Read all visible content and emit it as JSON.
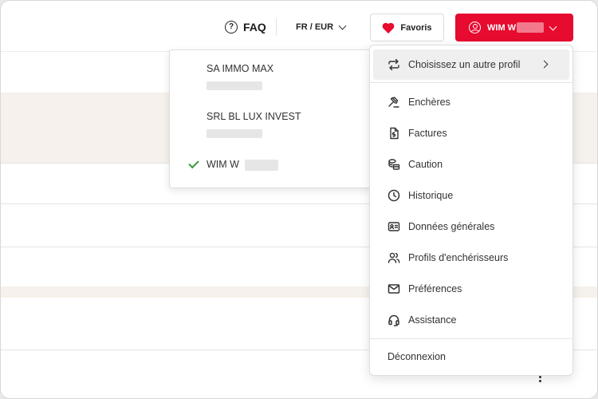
{
  "header": {
    "faq_label": "FAQ",
    "lang_label": "FR / EUR",
    "favorites_label": "Favoris",
    "profile_label": "WIM W"
  },
  "profile_submenu": {
    "items": [
      {
        "name": "SA IMMO MAX",
        "selected": false
      },
      {
        "name": "SRL BL LUX INVEST",
        "selected": false
      },
      {
        "name": "WIM W",
        "selected": true
      }
    ]
  },
  "menu": {
    "items": [
      {
        "label": "Choisissez un autre profil",
        "icon": "swap-icon"
      },
      {
        "label": "Enchères",
        "icon": "gavel-icon"
      },
      {
        "label": "Factures",
        "icon": "invoice-icon"
      },
      {
        "label": "Caution",
        "icon": "coins-icon"
      },
      {
        "label": "Historique",
        "icon": "clock-icon"
      },
      {
        "label": "Données générales",
        "icon": "id-card-icon"
      },
      {
        "label": "Profils d'enchérisseurs",
        "icon": "users-icon"
      },
      {
        "label": "Préférences",
        "icon": "mail-icon"
      },
      {
        "label": "Assistance",
        "icon": "headset-icon"
      }
    ],
    "logout_label": "Déconnexion"
  },
  "colors": {
    "brand_red": "#e60b2f",
    "check_green": "#3a9a3a",
    "band_beige": "#f6f1ec"
  }
}
